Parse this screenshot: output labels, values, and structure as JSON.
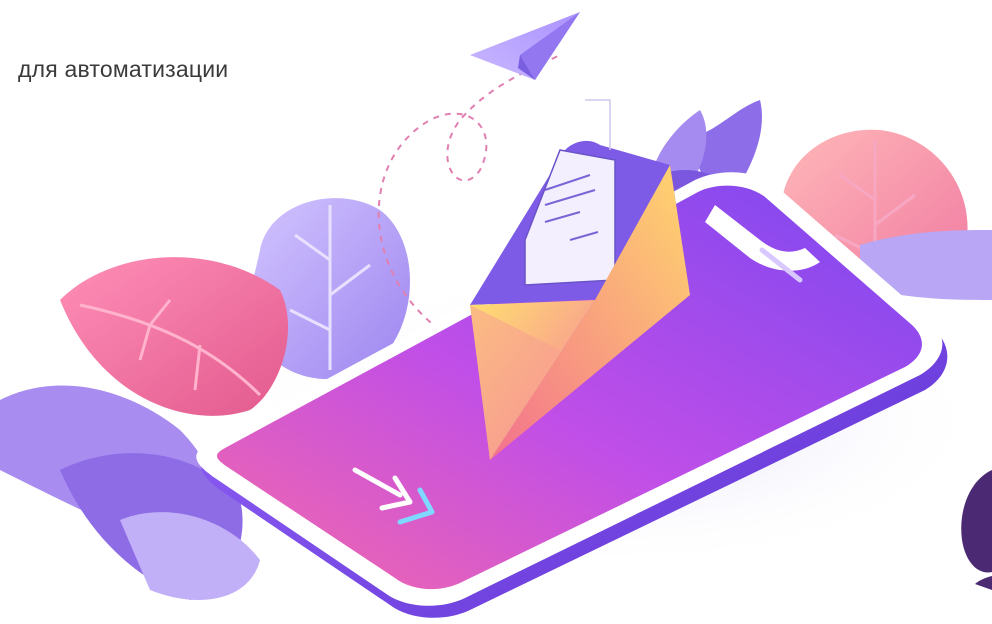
{
  "header": {
    "caption": "для автоматизации"
  },
  "illustration": {
    "subject": "smartphone with open envelope and paper plane",
    "colors": {
      "purple_dark": "#6b3fd6",
      "purple_light": "#c8b6ff",
      "pink": "#f2638f",
      "orange": "#f7a86a",
      "yellow": "#ffd86b",
      "leaf_pink": "#f47fa8",
      "leaf_violet": "#b8a4f4"
    }
  }
}
